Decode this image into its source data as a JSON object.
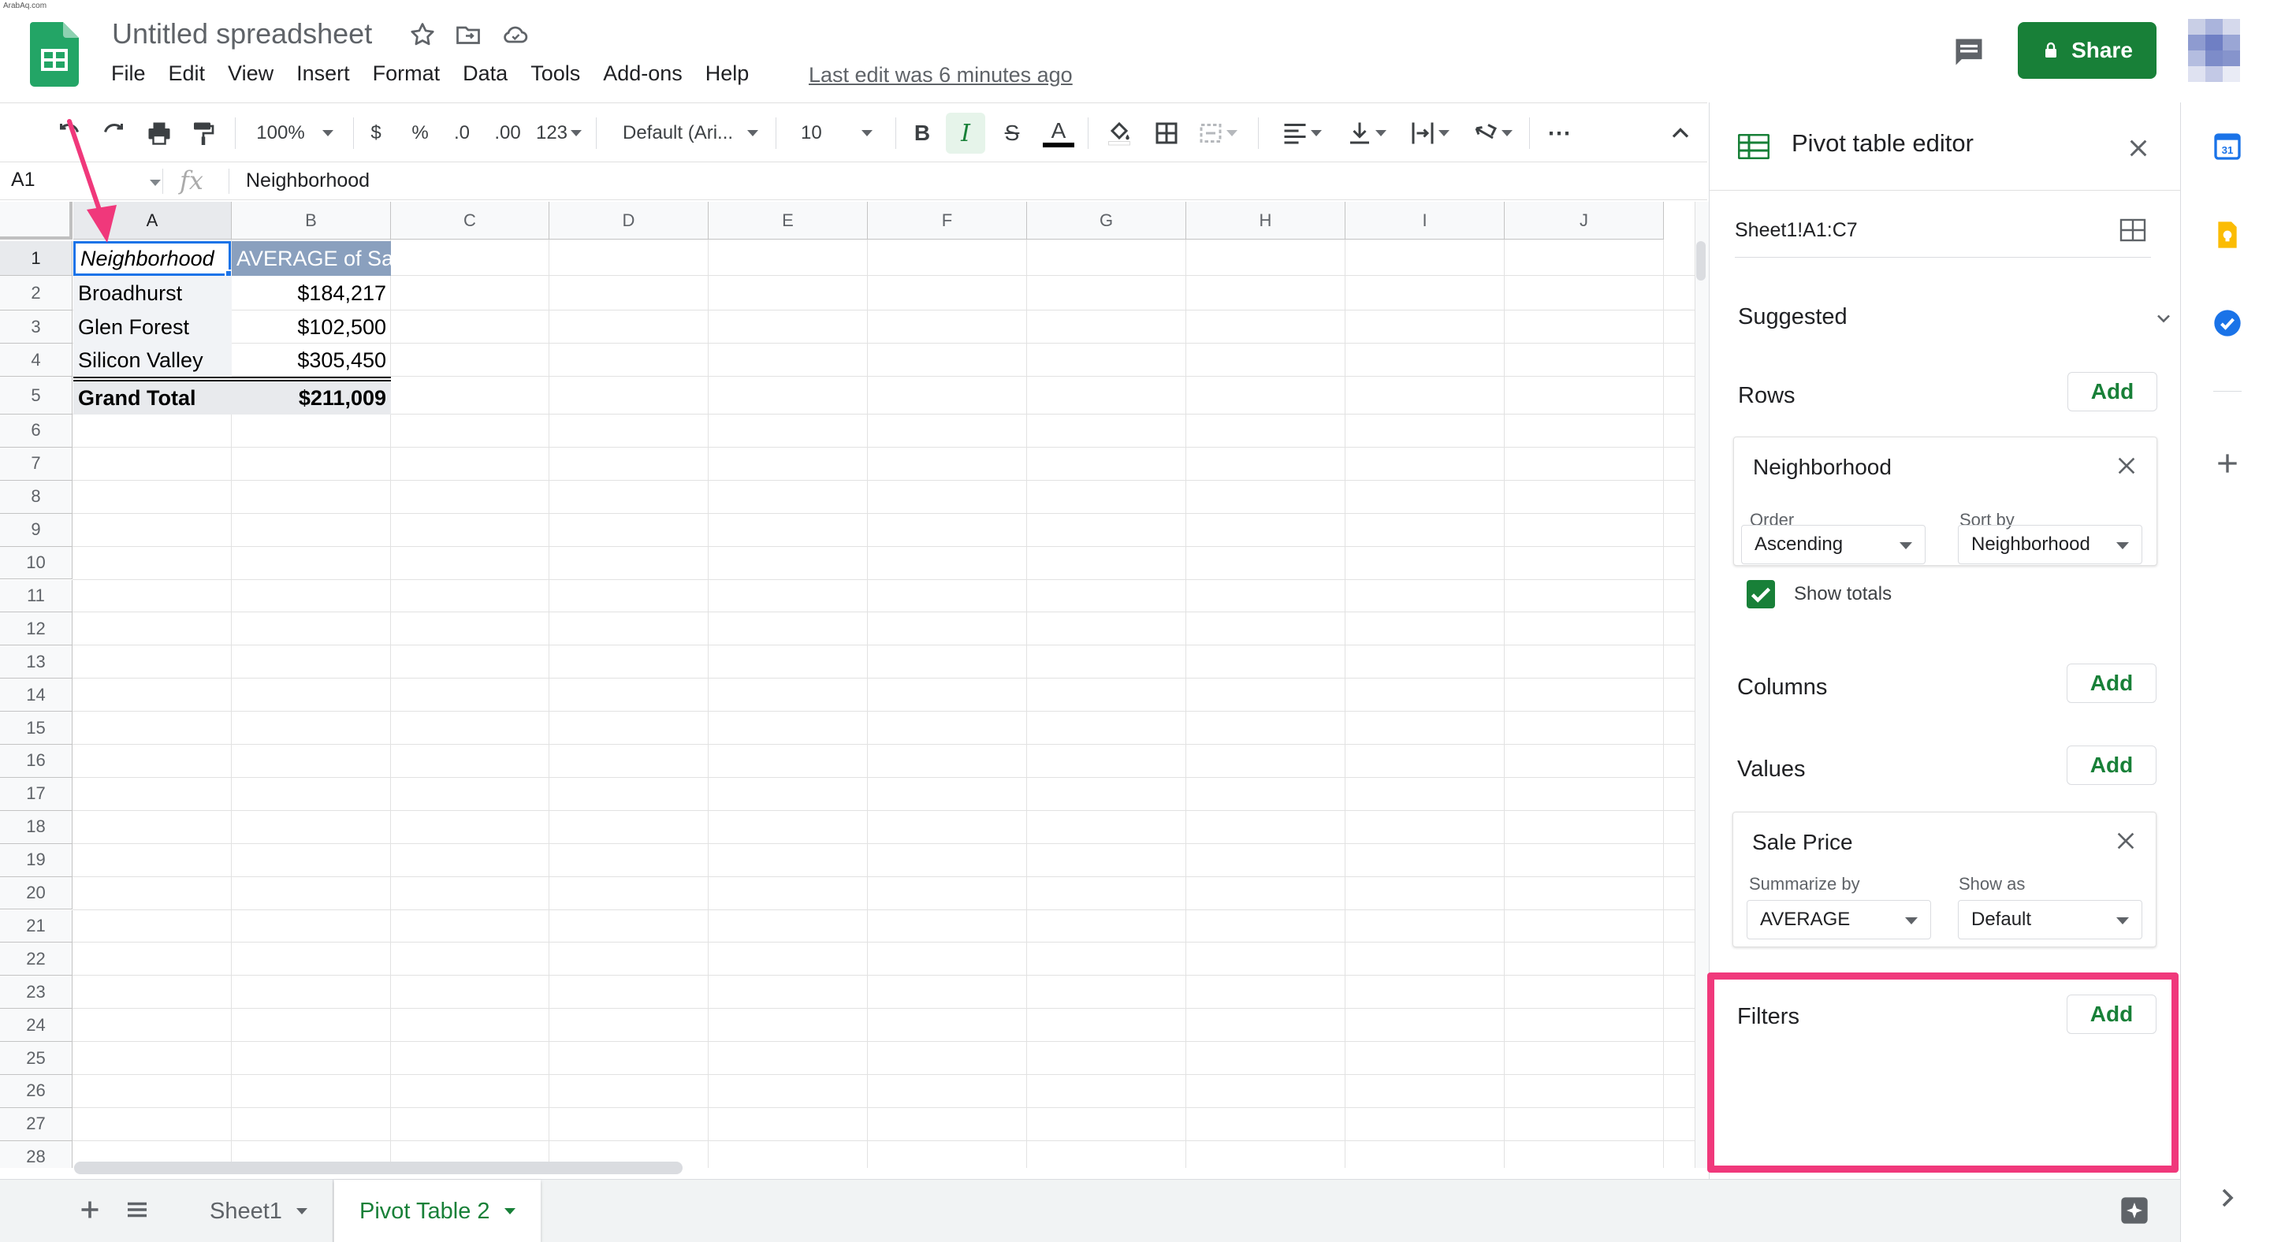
{
  "watermark": "ArabAq.com",
  "doc": {
    "title": "Untitled spreadsheet",
    "last_edit": "Last edit was 6 minutes ago"
  },
  "menu": [
    "File",
    "Edit",
    "View",
    "Insert",
    "Format",
    "Data",
    "Tools",
    "Add-ons",
    "Help"
  ],
  "share_label": "Share",
  "toolbar": {
    "zoom": "100%",
    "currency": "$",
    "percent": "%",
    "decrease_decimals": ".0",
    "increase_decimals": ".00",
    "more_formats": "123",
    "font": "Default (Ari...",
    "font_size": "10",
    "bold": "B",
    "italic": "I",
    "strike": "S",
    "text_color": "A",
    "more": "⋯"
  },
  "formula_bar": {
    "cell_ref": "A1",
    "fx": "fx",
    "value": "Neighborhood"
  },
  "columns": [
    "A",
    "B",
    "C",
    "D",
    "E",
    "F",
    "G",
    "H",
    "I",
    "J"
  ],
  "rows": [
    "1",
    "2",
    "3",
    "4",
    "5",
    "6",
    "7",
    "8",
    "9",
    "10",
    "11",
    "12",
    "13",
    "14",
    "15",
    "16",
    "17",
    "18",
    "19",
    "20",
    "21",
    "22",
    "23",
    "24",
    "25",
    "26",
    "27",
    "28"
  ],
  "cells": {
    "header_a": "Neighborhood",
    "header_b": "AVERAGE of Sa",
    "data": [
      {
        "name": "Broadhurst",
        "value": "$184,217"
      },
      {
        "name": "Glen Forest",
        "value": "$102,500"
      },
      {
        "name": "Silicon Valley",
        "value": "$305,450"
      }
    ],
    "total_label": "Grand Total",
    "total_value": "$211,009"
  },
  "sheets": {
    "tabs": [
      "Sheet1",
      "Pivot Table 2"
    ],
    "active": "Pivot Table 2"
  },
  "pivot_editor": {
    "title": "Pivot table editor",
    "range": "Sheet1!A1:C7",
    "suggested": "Suggested",
    "rows_label": "Rows",
    "columns_label": "Columns",
    "values_label": "Values",
    "filters_label": "Filters",
    "add_label": "Add",
    "row_field": {
      "name": "Neighborhood",
      "order_label": "Order",
      "order_value": "Ascending",
      "sort_label": "Sort by",
      "sort_value": "Neighborhood",
      "show_totals": "Show totals"
    },
    "value_field": {
      "name": "Sale Price",
      "summarize_label": "Summarize by",
      "summarize_value": "AVERAGE",
      "show_as_label": "Show as",
      "show_as_value": "Default"
    }
  },
  "colors": {
    "brand_green": "#188038",
    "highlight_pink": "#f0387b",
    "pivot_header_bg": "#8aa0be",
    "total_row_bg": "#e8eaed"
  }
}
